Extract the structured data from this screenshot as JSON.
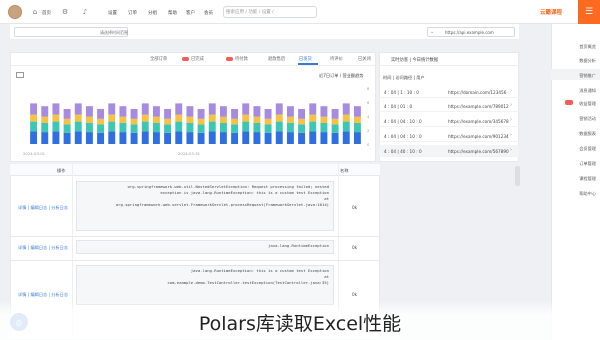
{
  "topbar": {
    "brand": "云霸课程",
    "search_placeholder": "搜索应用 / 功能 / 设置 /",
    "nav": [
      "首页",
      "设置",
      "订单",
      "分组",
      "帮助",
      "客户",
      "会员",
      "应用",
      "通知",
      "消息"
    ]
  },
  "sidebar": {
    "items": [
      "首页概览",
      "数据分析",
      "营销推广",
      "消息通知",
      "收益管理",
      "营销活动",
      "数据报表",
      "会员管理",
      "订单管理",
      "课程管理",
      "帮助中心"
    ],
    "active_index": 2
  },
  "subbar": {
    "left_label": "请选择时间范围",
    "right_value": "https://api.example.com"
  },
  "chart_panel": {
    "tabs": [
      "全部订单",
      "已完成",
      "待付款",
      "退款售后",
      "已发货",
      "待评价",
      "已关闭"
    ],
    "active_tab": 4,
    "title": "近7日订单 / 营业额趋势",
    "axis_left": "2024-03-01",
    "axis_right": "2024-03-31",
    "y_ticks": [
      "80",
      "60",
      "40",
      "20",
      "0"
    ]
  },
  "chart_data": {
    "type": "bar",
    "stacked": true,
    "categories": [
      "1",
      "2",
      "3",
      "4",
      "5",
      "6",
      "7",
      "8",
      "9",
      "10",
      "11",
      "12",
      "13",
      "14",
      "15",
      "16",
      "17",
      "18",
      "19",
      "20",
      "21",
      "22",
      "23",
      "24",
      "25",
      "26",
      "27",
      "28",
      "29",
      "30"
    ],
    "series": [
      {
        "color": "#2f6fe0",
        "values": [
          18,
          17,
          18,
          16,
          18,
          17,
          16,
          18,
          17,
          16,
          18,
          17,
          16,
          18,
          17,
          16,
          18,
          17,
          16,
          18,
          17,
          16,
          18,
          17,
          16,
          18,
          17,
          16,
          18,
          17
        ]
      },
      {
        "color": "#3cc6b4",
        "values": [
          14,
          13,
          14,
          12,
          14,
          13,
          12,
          14,
          13,
          12,
          14,
          13,
          12,
          14,
          13,
          12,
          14,
          13,
          12,
          14,
          13,
          12,
          14,
          13,
          12,
          14,
          13,
          12,
          14,
          13
        ]
      },
      {
        "color": "#f6c243",
        "values": [
          10,
          9,
          10,
          8,
          10,
          9,
          8,
          10,
          9,
          8,
          10,
          9,
          8,
          10,
          9,
          8,
          10,
          9,
          8,
          10,
          9,
          8,
          10,
          9,
          8,
          10,
          9,
          8,
          10,
          9
        ]
      },
      {
        "color": "#a78be0",
        "values": [
          16,
          15,
          16,
          14,
          16,
          15,
          14,
          16,
          15,
          14,
          16,
          15,
          14,
          16,
          15,
          14,
          16,
          15,
          14,
          16,
          15,
          14,
          16,
          15,
          14,
          16,
          15,
          14,
          16,
          15
        ]
      }
    ],
    "ylim": [
      0,
      80
    ]
  },
  "right_panel": {
    "title": "实时访客 | 今日统计数据",
    "subheader": "时间 | 访问路径 | 用户",
    "rows": [
      {
        "left": "4 : 04 | 1 : 10 : 0",
        "right": "https://domain.com/123456"
      },
      {
        "left": "4 : 04 | 01 : 0",
        "right": "https://example.com/789012"
      },
      {
        "left": "4 : 04 | 04 : 10 : 0",
        "right": "https://example.com/345678"
      },
      {
        "left": "4 : 04 | 04 : 10 : 0",
        "right": "https://example.com/901234"
      },
      {
        "left": "4 : 04 | 40 : 10 : 0",
        "right": "https://example.com/567890"
      }
    ]
  },
  "table": {
    "col_name": "名称",
    "col_op": "操作",
    "rows": [
      {
        "name": "0k",
        "code": "org.springframework.web.util.NestedServletException: Request processing failed; nested\nexception is java.lang.RuntimeException: this is a custom test Exception\n    at\norg.springframework.web.servlet.FrameworkServlet.processRequest(FrameworkServlet.java:1014)",
        "actions": "详情 | 编辑日志 | 分析日志"
      },
      {
        "name": "0k",
        "code": "java.lang.RuntimeException",
        "actions": "详情 | 编辑日志 | 分析日志"
      },
      {
        "name": "0k",
        "code": "java.lang.RuntimeException: this is a custom test Exception\n    at\ncom.example.demo.TestController.testException(TestController.java:35)",
        "actions": "详情 | 编辑日志 | 分析日志"
      }
    ]
  },
  "caption": "Polars库读取Excel性能"
}
